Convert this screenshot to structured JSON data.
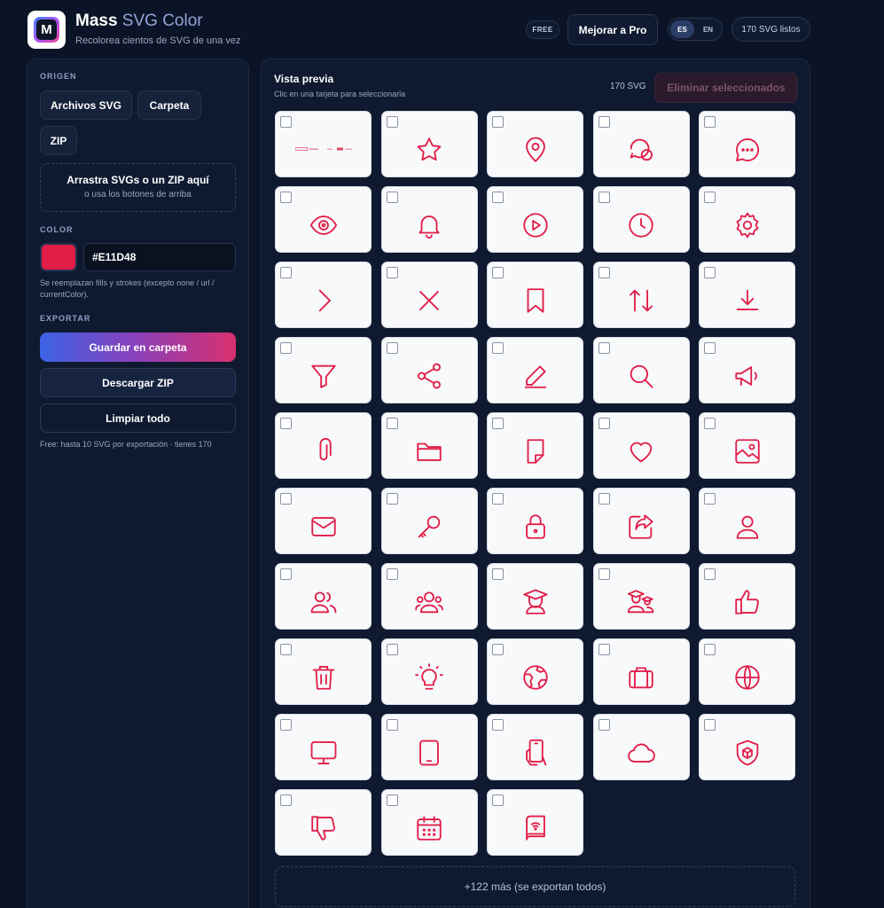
{
  "colors": {
    "accent": "#E11D48",
    "bg": "#0b1426",
    "panel": "#0f1a30"
  },
  "header": {
    "title_bold": "Mass",
    "title_light": " SVG Color",
    "subtitle": "Recolorea cientos de SVG de una vez",
    "plan_badge": "FREE",
    "upgrade_label": "Mejorar a Pro",
    "lang_es": "ES",
    "lang_en": "EN",
    "ready_status": "170 SVG listos"
  },
  "sidebar": {
    "origin_label": "ORIGEN",
    "files_button": "Archivos SVG",
    "folder_button": "Carpeta",
    "zip_button": "ZIP",
    "dropzone_title": "Arrastra SVGs o un ZIP aquí",
    "dropzone_hint": "o usa los botones de arriba",
    "color_label": "COLOR",
    "color_value": "#E11D48",
    "color_note": "Se reemplazan fills y strokes (excepto none / url / currentColor).",
    "export_label": "EXPORTAR",
    "save_folder_button": "Guardar en carpeta",
    "download_zip_button": "Descargar ZIP",
    "clear_button": "Limpiar todo",
    "limit_note": "Free: hasta 10 SVG por exportación · tienes 170"
  },
  "preview": {
    "title": "Vista previa",
    "hint": "Clic en una tarjeta para seleccionarla",
    "count": "170 SVG",
    "delete_selected_button": "Eliminar seleccionados",
    "more_text": "+122 más (se exportan todos)",
    "icons": [
      "mini-banner-icon",
      "star-icon",
      "location-pin-icon",
      "chat-bubbles-icon",
      "chat-dots-icon",
      "eye-icon",
      "bell-icon",
      "play-circle-icon",
      "clock-icon",
      "gear-icon",
      "chevron-right-icon",
      "close-icon",
      "bookmark-icon",
      "sort-arrows-icon",
      "download-icon",
      "filter-icon",
      "share-icon",
      "pencil-icon",
      "search-icon",
      "megaphone-icon",
      "paperclip-icon",
      "folder-icon",
      "note-icon",
      "heart-icon",
      "image-icon",
      "mail-icon",
      "key-icon",
      "lock-icon",
      "forward-icon",
      "user-icon",
      "users-icon",
      "group-icon",
      "graduate-icon",
      "graduates-icon",
      "thumbs-up-icon",
      "trash-icon",
      "lightbulb-icon",
      "earth-icon",
      "briefcase-icon",
      "globe-icon",
      "monitor-icon",
      "tablet-icon",
      "phone-hand-icon",
      "cloud-icon",
      "shield-box-icon",
      "thumbs-down-icon",
      "calendar-icon",
      "book-icon"
    ]
  }
}
